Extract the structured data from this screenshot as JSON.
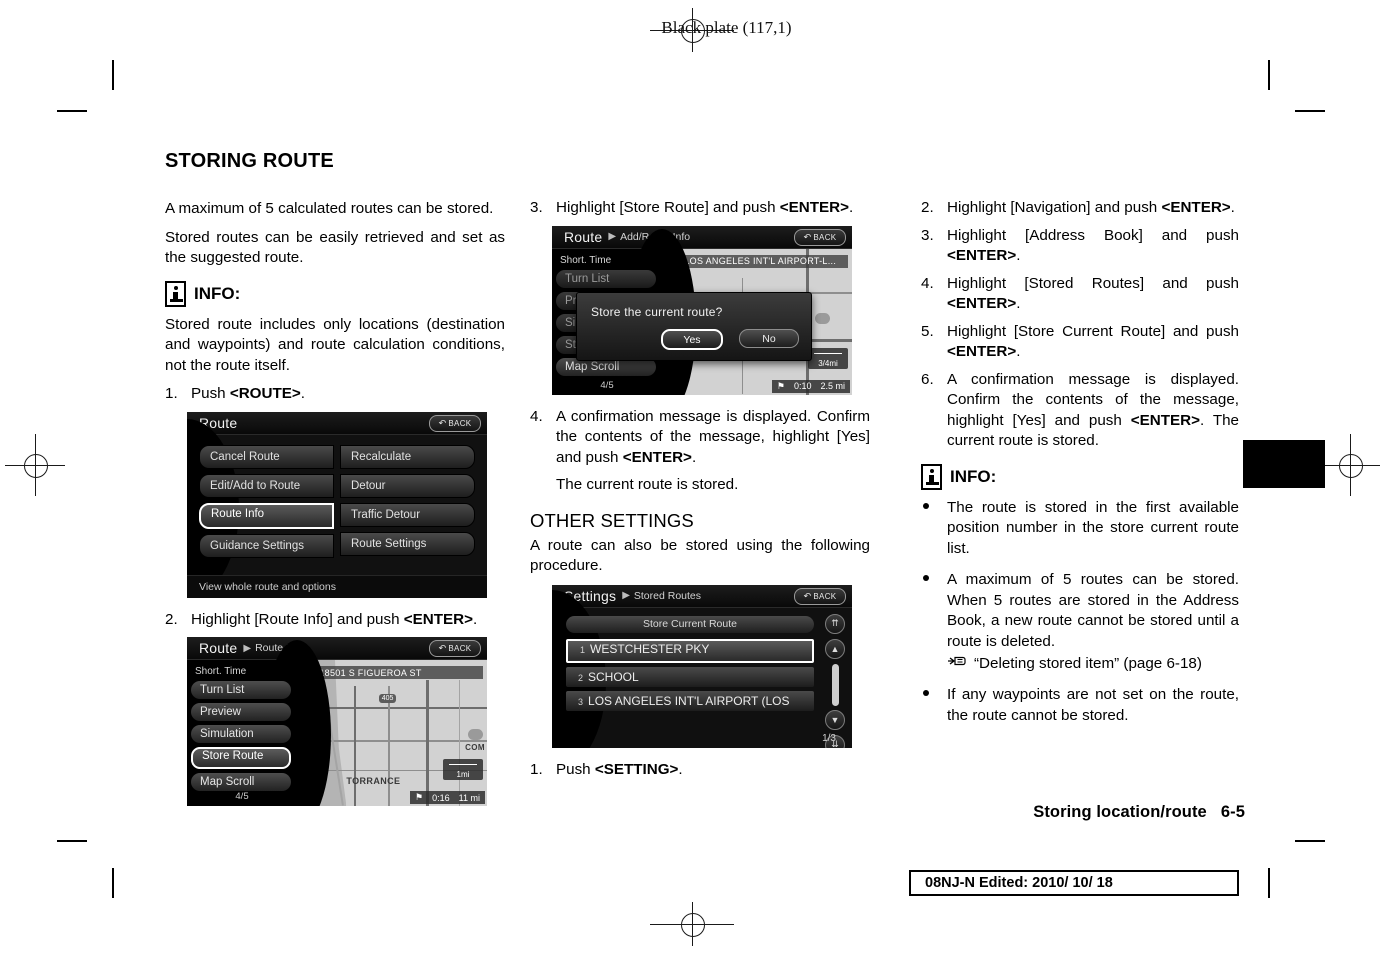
{
  "header": {
    "black_plate": "Black plate (117,1)"
  },
  "footer": {
    "section": "Storing location/route",
    "page_number": "6-5",
    "edited": "08NJ-N Edited:  2010/ 10/ 18"
  },
  "left_column": {
    "section_title": "STORING ROUTE",
    "intro_1": "A maximum of 5 calculated routes can be stored.",
    "intro_2": "Stored routes can be easily retrieved and set as the suggested route.",
    "info_label": "INFO:",
    "info_text": "Stored route includes only locations (destination and waypoints) and route calculation conditions, not the route itself.",
    "step1_num": "1.",
    "step1_text_pre": "Push ",
    "step1_key": "<ROUTE>",
    "step1_text_post": ".",
    "step2_num": "2.",
    "step2_text_pre": "Highlight [Route Info] and push ",
    "step2_key": "<ENTER>",
    "step2_text_post": "."
  },
  "mid_column": {
    "step3_num": "3.",
    "step3_text_pre": "Highlight [Store Route] and push ",
    "step3_key": "<ENTER>",
    "step3_text_post": ".",
    "step4_num": "4.",
    "step4_text_pre": "A confirmation message is displayed. Confirm the contents of the message, highlight [Yes] and push ",
    "step4_key": "<ENTER>",
    "step4_text_post": ".",
    "step4_sub": "The current route is stored.",
    "other_settings_title": "OTHER SETTINGS",
    "other_settings_text": "A route can also be stored using the following procedure.",
    "step1_num": "1.",
    "step1_text_pre": "Push ",
    "step1_key": "<SETTING>",
    "step1_text_post": "."
  },
  "right_column": {
    "step2_num": "2.",
    "step2_text_pre": "Highlight [Navigation] and push ",
    "step2_key": "<ENTER>",
    "step2_text_post": ".",
    "step3_num": "3.",
    "step3_text_pre": "Highlight [Address Book] and push ",
    "step3_key": "<ENTER>",
    "step3_text_post": ".",
    "step4_num": "4.",
    "step4_text_pre": "Highlight [Stored Routes] and push ",
    "step4_key": "<ENTER>",
    "step4_text_post": ".",
    "step5_num": "5.",
    "step5_text_pre": "Highlight [Store Current Route] and push ",
    "step5_key": "<ENTER>",
    "step5_text_post": ".",
    "step6_num": "6.",
    "step6_text_pre": "A confirmation message is displayed. Confirm the contents of the message, highlight [Yes] and push ",
    "step6_key": "<ENTER>",
    "step6_text_post": ". The current route is stored.",
    "info_label": "INFO:",
    "bullet1": "The route is stored in the first available position number in the store current route list.",
    "bullet2": "A maximum of 5 routes can be stored. When 5 routes are stored in the Address Book, a new route cannot be stored until a route is deleted.",
    "bullet2_ref": "“Deleting stored item” (page 6-18)",
    "bullet3": "If any waypoints are not set on the route, the route cannot be stored."
  },
  "nav_route_menu": {
    "title": "Route",
    "back_label": "BACK",
    "items_left": [
      "Cancel Route",
      "Edit/Add to Route",
      "Route Info",
      "Guidance Settings"
    ],
    "items_right": [
      "Recalculate",
      "Detour",
      "Traffic Detour",
      "Route Settings"
    ],
    "selected": "Route Info",
    "footer_hint": "View whole route and options"
  },
  "nav_route_info": {
    "title": "Route",
    "subtitle": "Route Info",
    "back_label": "BACK",
    "caption": "Short. Time",
    "items": [
      "Turn List",
      "Preview",
      "Simulation",
      "Store Route",
      "Map Scroll"
    ],
    "selected": "Store Route",
    "page_indicator": "4/5",
    "map_address": "18501 S FIGUEROA ST",
    "map_city": "TORRANCE",
    "map_poi": "COM",
    "map_shield": "405",
    "map_scale": "1mi",
    "eta_time": "0:16",
    "eta_distance": "11 mi"
  },
  "nav_add_route_info": {
    "title": "Route",
    "subtitle": "Add/Route Info",
    "back_label": "BACK",
    "caption": "Short. Time",
    "items": [
      "Turn List",
      "Prev",
      "Simu",
      "Stor",
      "Map Scroll"
    ],
    "page_indicator": "4/5",
    "map_address": "LOS ANGELES INT'L AIRPORT-L...",
    "map_scale": "3/4mi",
    "eta_time": "0:10",
    "eta_distance": "2.5 mi",
    "dialog_message": "Store the current route?",
    "dialog_yes": "Yes",
    "dialog_no": "No",
    "dialog_selected": "Yes"
  },
  "nav_stored_routes": {
    "title": "Settings",
    "subtitle": "Stored Routes",
    "back_label": "BACK",
    "store_current_label": "Store Current Route",
    "rows": [
      {
        "index": "1",
        "label": "WESTCHESTER PKY"
      },
      {
        "index": "2",
        "label": "SCHOOL"
      },
      {
        "index": "3",
        "label": "LOS ANGELES INT'L AIRPORT (LOS"
      }
    ],
    "selected_index": "1",
    "page_indicator": "1/3"
  }
}
